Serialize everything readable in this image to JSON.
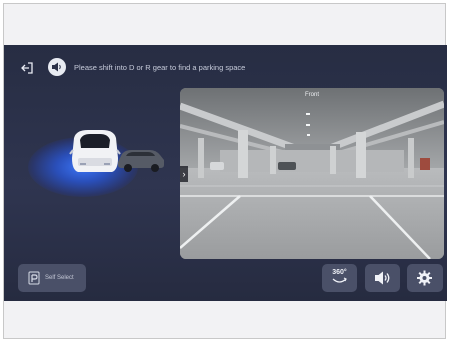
{
  "top": {
    "message": "Please shift into D or R gear to find a parking space",
    "exit_icon": "exit-icon",
    "voice_icon": "speaker-icon"
  },
  "camera": {
    "view_label": "Front",
    "nav_arrow": "›"
  },
  "controls": {
    "self_select_label": "Self Select",
    "view_360_label": "360°",
    "volume_icon": "volume-icon",
    "settings_icon": "gear-icon"
  },
  "colors": {
    "screen_bg": "#2a3048",
    "button_bg": "#4a5068",
    "sensor_glow": "#3c78ff"
  }
}
